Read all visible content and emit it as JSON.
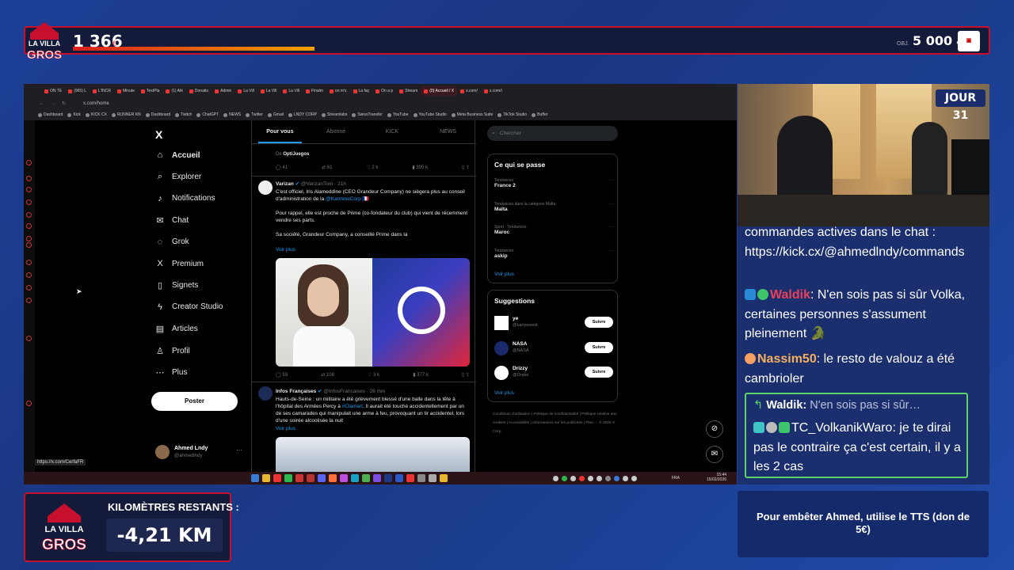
{
  "overlay": {
    "logo_text": "LA VILLA DES GROS",
    "current_amount": "1 366",
    "current_unit": "€",
    "goal_label": "OBJ.",
    "goal_amount": "5 000",
    "goal_unit": "€",
    "progress_fraction": 0.27,
    "day_label": "JOUR 31",
    "km_label": "KILOMÈTRES RESTANTS :",
    "km_value": "-4,21 KM",
    "tts_text": "Pour embêter Ahmed, utilise le TTS (don de 5€)",
    "accent_color": "#c8102e",
    "bg_color": "#1a3a8c"
  },
  "browser": {
    "tabs": [
      "ON TE",
      "(965) L",
      "L'INCR",
      "Minute",
      "TextPla",
      "(1) Alé",
      "Donatio",
      "Admin",
      "La Vill",
      "La Vill",
      "La Vill",
      "Finalm",
      "on m's",
      "La faç",
      "On a p",
      "Stream",
      "(0) Accueil / X",
      "x.com/",
      "x.com/i"
    ],
    "active_tab_index": 16,
    "address": "x.com/home",
    "bookmarks": [
      "Dashboard",
      "Kick",
      "KICK CX",
      "RUNNER KN",
      "Dashboard",
      "Twitch",
      "ChatGPT",
      "NEWS",
      "Twitter",
      "Gmail",
      "LNDY CORP",
      "Streamlabs",
      "SwissTransfer",
      "YouTube",
      "YouTube Studio",
      "Meta Business Suite",
      "TikTok Studio",
      "Buffer"
    ],
    "status_url": "https://x.com/CerfaFR"
  },
  "x": {
    "logo": "X",
    "nav": [
      {
        "label": "Accueil",
        "icon": "home-icon",
        "glyph": "⌂"
      },
      {
        "label": "Explorer",
        "icon": "search-icon",
        "glyph": "⌕"
      },
      {
        "label": "Notifications",
        "icon": "bell-icon",
        "glyph": "♪"
      },
      {
        "label": "Chat",
        "icon": "mail-icon",
        "glyph": "✉"
      },
      {
        "label": "Grok",
        "icon": "grok-icon",
        "glyph": "◌"
      },
      {
        "label": "Premium",
        "icon": "x-icon",
        "glyph": "X"
      },
      {
        "label": "Signets",
        "icon": "bookmark-icon",
        "glyph": "▯"
      },
      {
        "label": "Creator Studio",
        "icon": "lightning-icon",
        "glyph": "ϟ"
      },
      {
        "label": "Articles",
        "icon": "document-icon",
        "glyph": "▤"
      },
      {
        "label": "Profil",
        "icon": "user-icon",
        "glyph": "♙"
      },
      {
        "label": "Plus",
        "icon": "more-circle-icon",
        "glyph": "⋯"
      }
    ],
    "post_button": "Poster",
    "account": {
      "name": "Ahmed Lndy",
      "handle": "@ahmedlndy",
      "more": "···"
    },
    "feed_tabs": [
      "Pour vous",
      "Abonné",
      "KICK",
      "NEWS"
    ],
    "prev_tweet": {
      "via_prefix": "De",
      "via_name": "OptiJuegos",
      "actions": [
        "41",
        "61",
        "2 k",
        "395 k"
      ]
    },
    "tweets": [
      {
        "name": "Varizan",
        "handle": "@VarizanTom · 21h",
        "body1": "C'est officiel, Iris Alameddine (CEO Grandeur Company) ne siègera plus au conseil d'administration de la ",
        "link1": "@KarmineCorp",
        "body2": "Pour rappel, elle est proche de Prime (co-fondateur du club) qui vient de récemment vendre ses parts.",
        "body3": "Sa société, Grandeur Company, a conseillé Prime dans la",
        "more": "Voir plus",
        "actions": [
          "59",
          "108",
          "3 k",
          "377 k"
        ]
      },
      {
        "name": "Infos Françaises",
        "handle": "@InfosFrancaises · 26 min",
        "body1": "Hauts-de-Seine : un militaire a été grièvement blessé d'une balle dans la tête à l'hôpital des Armées Percy à ",
        "link1": "#Clamart",
        "body2": ". Il aurait été touché accidentellement par un de ses camarades qui manipulait une arme à feu, provoquant un tir accidentel, lors d'une soirée alcoolisée la nuit",
        "more": "Voir plus"
      }
    ],
    "search_placeholder": "Chercher",
    "trending_title": "Ce qui se passe",
    "trends": [
      {
        "context": "Tendances",
        "name": "France 2"
      },
      {
        "context": "Tendances dans la catégorie Malta",
        "name": "Malta"
      },
      {
        "context": "Sport · Tendances",
        "name": "Maroc"
      },
      {
        "context": "Tendances",
        "name": "askip"
      }
    ],
    "trends_more": "Voir plus",
    "suggestions_title": "Suggestions",
    "suggestions": [
      {
        "name": "ye",
        "handle": "@kanyewest",
        "button": "Suivre"
      },
      {
        "name": "NASA",
        "handle": "@NASA",
        "button": "Suivre"
      },
      {
        "name": "Drizzy",
        "handle": "@Drake",
        "button": "Suivre"
      }
    ],
    "suggestions_more": "Voir plus",
    "footer": "Conditions d'utilisation | Politique de Confidentialité | Politique relative aux cookies | Accessibilité | Informations sur les publicités | Plus ··· © 2026 X Corp."
  },
  "taskbar": {
    "lang": "FRA",
    "time": "15:44",
    "date": "15/02/2026"
  },
  "chat": {
    "messages": [
      {
        "text": "commandes actives dans le chat : https://kick.cx/@ahmedlndy/commands"
      },
      {
        "user": "Waldik",
        "text": "N'en sois pas si sûr Volka, certaines personnes s'assument pleinement 🐊"
      },
      {
        "user": "Nassim50",
        "text": "le resto de valouz a été cambrioler"
      }
    ],
    "reply": {
      "to_user": "Waldik:",
      "quote": "N'en sois pas si sûr…",
      "user": "TC_VolkanikWaro",
      "text": "je te dirai pas le contraire ça c'est certain, il y a les 2 cas"
    }
  }
}
